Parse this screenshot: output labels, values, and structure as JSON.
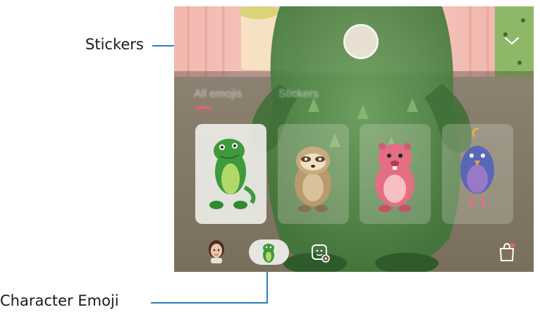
{
  "callouts": {
    "stickers": "Stickers",
    "character_emoji": "Character Emoji"
  },
  "tabs": [
    {
      "label": "All emojis"
    },
    {
      "label": "Stickers"
    }
  ],
  "characters": [
    {
      "name": "dinosaur",
      "selected": true
    },
    {
      "name": "sloth",
      "selected": false
    },
    {
      "name": "beaver",
      "selected": false
    },
    {
      "name": "bird",
      "selected": false
    }
  ],
  "colors": {
    "accent_line": "#2e7fb5",
    "tab_indicator": "#e4636b",
    "badge": "#e4636b"
  },
  "icons": [
    "chevron-down-icon",
    "my-emoji-avatar-icon",
    "character-emoji-icon",
    "sticker-settings-icon",
    "store-bag-icon"
  ]
}
